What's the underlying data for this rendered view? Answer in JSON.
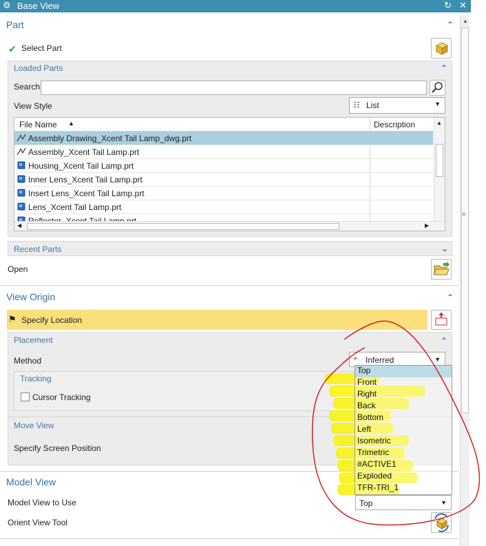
{
  "window": {
    "title": "Base View"
  },
  "part": {
    "heading": "Part",
    "select_part": "Select Part",
    "loaded_parts": {
      "heading": "Loaded Parts",
      "search_label": "Search",
      "search_value": "",
      "view_style_label": "View Style",
      "view_style_value": "List",
      "columns": [
        "File Name",
        "Description"
      ],
      "files": [
        "Assembly Drawing_Xcent Tail Lamp_dwg.prt",
        "Assembly_Xcent Tail Lamp.prt",
        "Housing_Xcent Tail Lamp.prt",
        "Inner Lens_Xcent Tail Lamp.prt",
        "Insert Lens_Xcent Tail Lamp.prt",
        "Lens_Xcent Tail Lamp.prt",
        "Reflector_Xcent Tail Lamp.prt"
      ],
      "selected_index": 0
    },
    "recent_parts": "Recent Parts",
    "open_label": "Open"
  },
  "view_origin": {
    "heading": "View Origin",
    "specify_location": "Specify Location",
    "placement": {
      "heading": "Placement",
      "method_label": "Method",
      "method_value": "Inferred",
      "tracking_heading": "Tracking",
      "cursor_tracking": "Cursor Tracking"
    },
    "move_view": {
      "heading": "Move View",
      "specify_screen_position": "Specify Screen Position"
    }
  },
  "model_view": {
    "heading": "Model View",
    "model_view_to_use_label": "Model View to Use",
    "model_view_to_use_value": "Top",
    "orient_view_tool": "Orient View Tool",
    "options": [
      "Top",
      "Front",
      "Right",
      "Back",
      "Bottom",
      "Left",
      "Isometric",
      "Trimetric",
      "#ACTIVE1",
      "Exploded",
      "TFR-TRI_1"
    ],
    "highlighted_index": 0
  },
  "colors": {
    "titlebar": "#3c8fb0",
    "section_heading": "#3272a0",
    "selected_row": "#a9cfe0",
    "yellow_bar": "#fbdf7a",
    "highlighter": "#f8f21f",
    "annotation_circle": "#d42020"
  },
  "icons": {
    "titlebar": "gear-icon",
    "reset": "reset-icon",
    "close": "close-icon",
    "select_part": "checkmark-icon",
    "search": "magnifier-icon",
    "open": "folder-open-icon",
    "specify_location": "checkered-flag-icon"
  }
}
